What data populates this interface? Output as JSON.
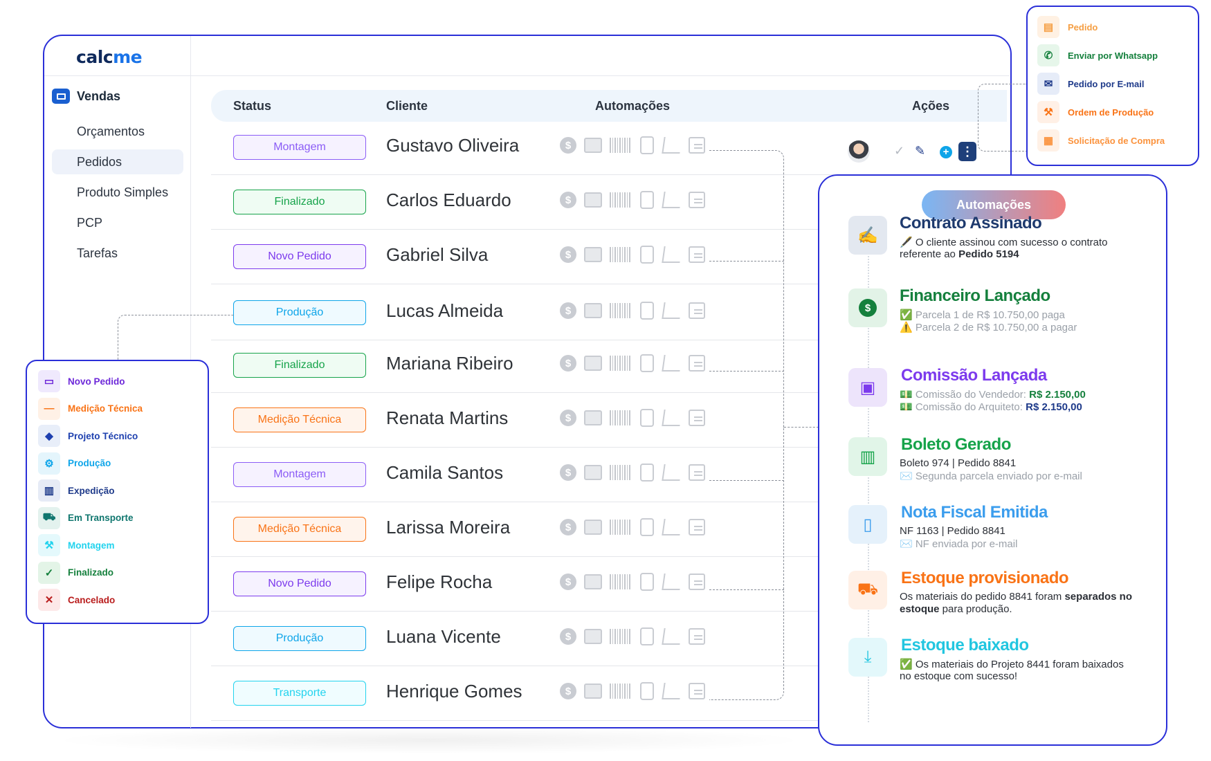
{
  "app": {
    "logo_calc": "calc",
    "logo_me": "me"
  },
  "sidebar": {
    "section": "Vendas",
    "items": [
      {
        "label": "Orçamentos",
        "active": false
      },
      {
        "label": "Pedidos",
        "active": true
      },
      {
        "label": "Produto Simples",
        "active": false
      },
      {
        "label": "PCP",
        "active": false
      },
      {
        "label": "Tarefas",
        "active": false
      }
    ]
  },
  "table": {
    "headers": {
      "status": "Status",
      "cliente": "Cliente",
      "automacoes": "Automações",
      "acoes": "Ações"
    },
    "rows": [
      {
        "status": "Montagem",
        "cliente": "Gustavo Oliveira"
      },
      {
        "status": "Finalizado",
        "cliente": "Carlos Eduardo"
      },
      {
        "status": "Novo Pedido",
        "cliente": "Gabriel Silva"
      },
      {
        "status": "Produção",
        "cliente": "Lucas Almeida"
      },
      {
        "status": "Finalizado",
        "cliente": "Mariana Ribeiro"
      },
      {
        "status": "Medição Técnica",
        "cliente": "Renata Martins"
      },
      {
        "status": "Montagem",
        "cliente": "Camila Santos"
      },
      {
        "status": "Medição Técnica",
        "cliente": "Larissa Moreira"
      },
      {
        "status": "Novo Pedido",
        "cliente": "Felipe Rocha"
      },
      {
        "status": "Produção",
        "cliente": "Luana Vicente"
      },
      {
        "status": "Transporte",
        "cliente": "Henrique Gomes"
      }
    ],
    "automation_icons": [
      "dollar-icon",
      "wallet-icon",
      "barcode-icon",
      "invoice-icon",
      "cart-icon",
      "note-icon"
    ],
    "action_icons": [
      "avatar",
      "check-icon",
      "pencil-icon",
      "plus-icon",
      "kebab-icon"
    ]
  },
  "status_colors": {
    "Montagem": "#8b5cf6",
    "Finalizado": "#16a34a",
    "Novo Pedido": "#7c3aed",
    "Produção": "#0ea5e9",
    "Medição Técnica": "#f97316",
    "Transporte": "#22d3ee"
  },
  "actions_menu": [
    {
      "label": "Pedido",
      "icon": "pdf-icon",
      "color": "#f59e42"
    },
    {
      "label": "Enviar por Whatsapp",
      "icon": "whatsapp-icon",
      "color": "#15803d"
    },
    {
      "label": "Pedido por E-mail",
      "icon": "email-icon",
      "color": "#1e3a8a"
    },
    {
      "label": "Ordem de Produção",
      "icon": "tools-icon",
      "color": "#f97316"
    },
    {
      "label": "Solicitação de Compra",
      "icon": "purchase-icon",
      "color": "#fb923c"
    }
  ],
  "status_legend": [
    {
      "label": "Novo Pedido",
      "icon": "folder-icon",
      "color": "#6d28d9"
    },
    {
      "label": "Medição Técnica",
      "icon": "ruler-icon",
      "color": "#f97316"
    },
    {
      "label": "Projeto Técnico",
      "icon": "cube-icon",
      "color": "#1e40af"
    },
    {
      "label": "Produção",
      "icon": "gears-icon",
      "color": "#0ea5e9"
    },
    {
      "label": "Expedição",
      "icon": "boxes-icon",
      "color": "#1e3a8a"
    },
    {
      "label": "Em Transporte",
      "icon": "truck-icon",
      "color": "#0f766e"
    },
    {
      "label": "Montagem",
      "icon": "assembly-icon",
      "color": "#22d3ee"
    },
    {
      "label": "Finalizado",
      "icon": "check-icon",
      "color": "#15803d"
    },
    {
      "label": "Cancelado",
      "icon": "x-icon",
      "color": "#b91c1c"
    }
  ],
  "automations": {
    "title": "Automações",
    "events": [
      {
        "title": "Contrato Assinado",
        "color": "#1e3a6e",
        "icon": "contract-icon",
        "lines": [
          "🖋️ O cliente assinou com sucesso o contrato",
          "referente ao "
        ],
        "bold": "Pedido 5194"
      },
      {
        "title": "Financeiro Lançado",
        "color": "#15803d",
        "icon": "dollar-icon",
        "lines": [
          "✅ Parcela 1 de R$ 10.750,00 paga",
          "⚠️ Parcela 2 de R$ 10.750,00 a pagar"
        ]
      },
      {
        "title": "Comissão Lançada",
        "color": "#7c3aed",
        "icon": "wallet-icon",
        "lines": [
          "💵 Comissão do Vendedor: ",
          "💵 Comissão do Arquiteto: "
        ],
        "values": [
          "R$ 2.150,00",
          "R$ 2.150,00"
        ]
      },
      {
        "title": "Boleto Gerado",
        "color": "#16a34a",
        "icon": "barcode-icon",
        "lines": [
          "Boleto 974 | Pedido 8841",
          "✉️ Segunda parcela enviado por e-mail"
        ]
      },
      {
        "title": "Nota Fiscal Emitida",
        "color": "#3b9ded",
        "icon": "invoice-icon",
        "lines": [
          "NF 1163 | Pedido 8841",
          "✉️ NF enviada por e-mail"
        ]
      },
      {
        "title": "Estoque provisionado",
        "color": "#f97316",
        "icon": "cart-icon",
        "lines": [
          "Os materiais do pedido 8841 foram ",
          "separados no",
          "estoque",
          " para produção."
        ]
      },
      {
        "title": "Estoque baixado",
        "color": "#22c6e0",
        "icon": "download-icon",
        "lines": [
          "✅ Os materiais do Projeto 8441 foram baixados",
          "no estoque com sucesso!"
        ]
      }
    ]
  }
}
